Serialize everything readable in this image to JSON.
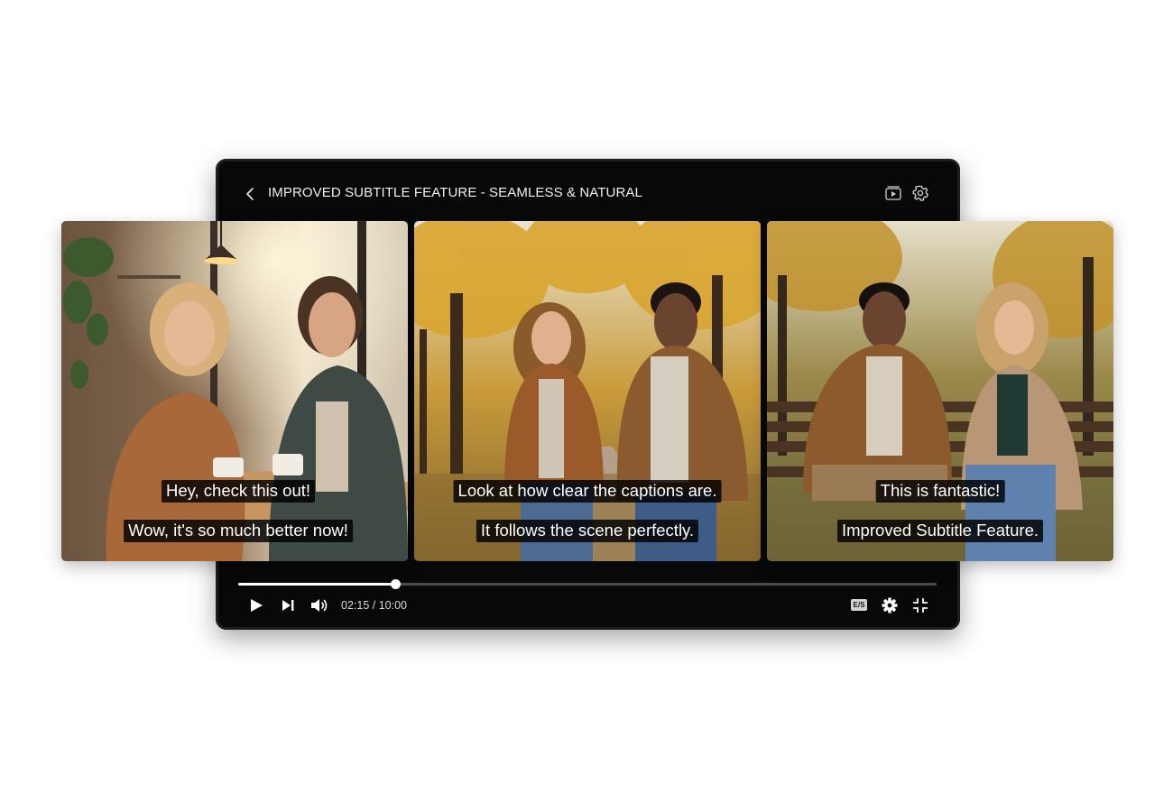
{
  "header": {
    "title": "IMPROVED SUBTITLE FEATURE - SEAMLESS & NATURAL",
    "icons": [
      "back-icon",
      "playlist-icon",
      "settings-gear-outline-icon"
    ]
  },
  "scenes": [
    {
      "setting": "cafe",
      "subtitles": [
        "Hey, check this out!",
        "Wow, it's so much better now!"
      ]
    },
    {
      "setting": "autumn-park-walk",
      "subtitles": [
        "Look at how clear the captions are.",
        "It follows the scene perfectly."
      ]
    },
    {
      "setting": "park-bench",
      "subtitles": [
        "This is fantastic!",
        "Improved Subtitle Feature."
      ]
    }
  ],
  "controls": {
    "time_display": "02:15 / 10:00",
    "progress": 0.225,
    "cc_label": "E/S",
    "icons": [
      "play-icon",
      "skip-next-icon",
      "volume-icon",
      "subtitles-icon",
      "settings-gear-icon",
      "exit-fullscreen-icon"
    ]
  },
  "colors": {
    "player_bg": "#070809",
    "subtitle_bg": "#000000",
    "subtitle_text": "#ffffff",
    "progress_fill": "#ffffff",
    "progress_track": "#4a4c50"
  }
}
